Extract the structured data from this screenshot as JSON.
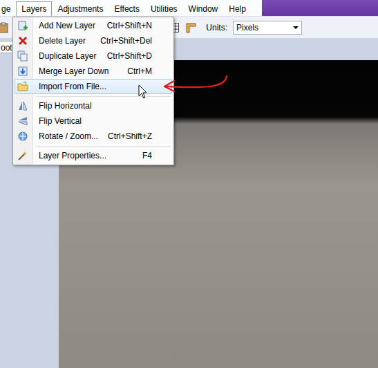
{
  "menubar": {
    "items": [
      {
        "label": "ge",
        "selected": false
      },
      {
        "label": "Layers",
        "selected": true
      },
      {
        "label": "Adjustments",
        "selected": false
      },
      {
        "label": "Effects",
        "selected": false
      },
      {
        "label": "Utilities",
        "selected": false
      },
      {
        "label": "Window",
        "selected": false
      },
      {
        "label": "Help",
        "selected": false
      }
    ]
  },
  "toolbar": {
    "field_text": "ooth",
    "units_label": "Units:",
    "units_value": "Pixels"
  },
  "layers_menu": {
    "groups": [
      [
        {
          "label": "Add New Layer",
          "shortcut": "Ctrl+Shift+N",
          "selected": false
        },
        {
          "label": "Delete Layer",
          "shortcut": "Ctrl+Shift+Del",
          "selected": false
        },
        {
          "label": "Duplicate Layer",
          "shortcut": "Ctrl+Shift+D",
          "selected": false
        },
        {
          "label": "Merge Layer Down",
          "shortcut": "Ctrl+M",
          "selected": false
        },
        {
          "label": "Import From File...",
          "selected": true
        }
      ],
      [
        {
          "label": "Flip Horizontal",
          "selected": false
        },
        {
          "label": "Flip Vertical",
          "selected": false
        },
        {
          "label": "Rotate / Zoom...",
          "shortcut": "Ctrl+Shift+Z",
          "selected": false
        }
      ],
      [
        {
          "label": "Layer Properties...",
          "shortcut": "F4",
          "selected": false
        }
      ]
    ]
  }
}
